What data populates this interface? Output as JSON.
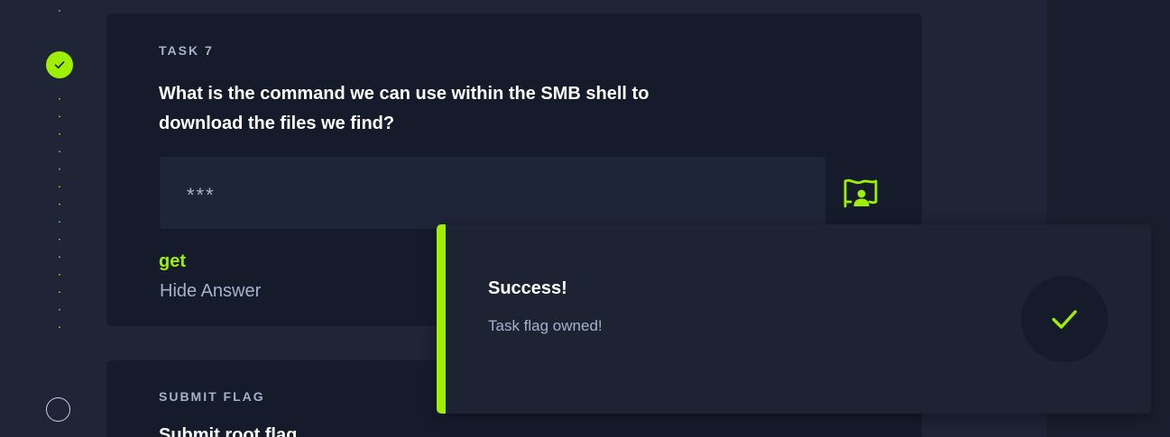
{
  "timeline": {
    "steps": [
      {
        "status": "completed",
        "icon": "check-icon"
      },
      {
        "status": "pending",
        "icon": "circle-icon"
      }
    ]
  },
  "task": {
    "label": "TASK 7",
    "question": "What is the command we can use within the SMB shell to download the files we find?",
    "answer_masked": "***",
    "answer": "get",
    "hide_answer_label": "Hide Answer",
    "submit_icon": "flag-user-icon"
  },
  "submit_flag": {
    "label": "SUBMIT FLAG",
    "question": "Submit root flag"
  },
  "toast": {
    "title": "Success!",
    "message": "Task flag owned!",
    "icon": "check-icon"
  },
  "colors": {
    "accent": "#9fef00",
    "background": "#1f2436",
    "card": "#161b2c",
    "muted_text": "#a4b1cd"
  }
}
